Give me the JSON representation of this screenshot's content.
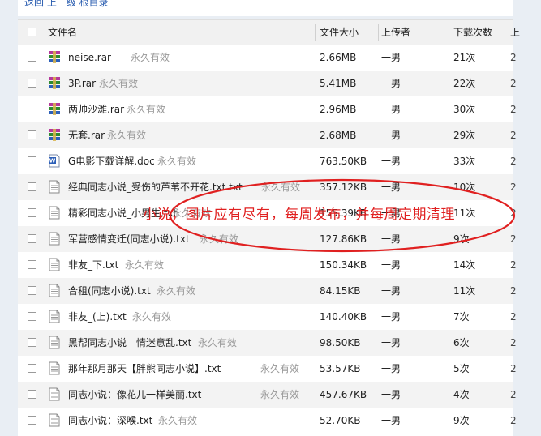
{
  "breadcrumb": "返回  上一级  根目录",
  "headers": {
    "name": "文件名",
    "size": "文件大小",
    "uploader": "上传者",
    "downloads": "下载次数",
    "extra": "上"
  },
  "colors": {
    "annotation": "#e02020",
    "rar_icon": "#2f8a2f",
    "doc_icon": "#2c5fb8"
  },
  "files": [
    {
      "name": "neise.rar",
      "perm": "永久有效",
      "size": "2.66MB",
      "uploader": "一男",
      "downloads": "21次",
      "icon": "winrar-icon",
      "extra": "2"
    },
    {
      "name": "3P.rar",
      "perm": "永久有效",
      "size": "5.41MB",
      "uploader": "一男",
      "downloads": "22次",
      "icon": "winrar-icon",
      "extra": "2"
    },
    {
      "name": "两帅沙滩.rar",
      "perm": "永久有效",
      "size": "2.96MB",
      "uploader": "一男",
      "downloads": "30次",
      "icon": "winrar-icon",
      "extra": "2"
    },
    {
      "name": "无套.rar",
      "perm": "永久有效",
      "size": "2.68MB",
      "uploader": "一男",
      "downloads": "29次",
      "icon": "winrar-icon",
      "extra": "2"
    },
    {
      "name": "G电影下载详解.doc",
      "perm": "永久有效",
      "size": "763.50KB",
      "uploader": "一男",
      "downloads": "33次",
      "icon": "word-doc-icon",
      "extra": "2"
    },
    {
      "name": "经典同志小说_受伤的芦苇不开花.txt.txt",
      "perm": "永久有效",
      "size": "357.12KB",
      "uploader": "一男",
      "downloads": "10次",
      "icon": "text-file-icon",
      "extra": "2"
    },
    {
      "name": "精彩同志小说_小男生.txt",
      "perm": "永久有效",
      "size": "155.39KB",
      "uploader": "一男",
      "downloads": "11次",
      "icon": "text-file-icon",
      "extra": "2"
    },
    {
      "name": "军营感情变迁(同志小说).txt",
      "perm": "永久有效",
      "size": "127.86KB",
      "uploader": "一男",
      "downloads": "9次",
      "icon": "text-file-icon",
      "extra": "2"
    },
    {
      "name": "非友_下.txt",
      "perm": "永久有效",
      "size": "150.34KB",
      "uploader": "一男",
      "downloads": "14次",
      "icon": "text-file-icon",
      "extra": "2"
    },
    {
      "name": "合租(同志小说).txt",
      "perm": "永久有效",
      "size": "84.15KB",
      "uploader": "一男",
      "downloads": "11次",
      "icon": "text-file-icon",
      "extra": "2"
    },
    {
      "name": "非友_(上).txt",
      "perm": "永久有效",
      "size": "140.40KB",
      "uploader": "一男",
      "downloads": "7次",
      "icon": "text-file-icon",
      "extra": "2"
    },
    {
      "name": "黑帮同志小说__情迷意乱.txt",
      "perm": "永久有效",
      "size": "98.50KB",
      "uploader": "一男",
      "downloads": "6次",
      "icon": "text-file-icon",
      "extra": "2"
    },
    {
      "name": "那年那月那天【胖熊同志小说】.txt",
      "perm": "永久有效",
      "size": "53.57KB",
      "uploader": "一男",
      "downloads": "5次",
      "icon": "text-file-icon",
      "extra": "2"
    },
    {
      "name": "同志小说：像花儿一样美丽.txt",
      "perm": "永久有效",
      "size": "457.67KB",
      "uploader": "一男",
      "downloads": "4次",
      "icon": "text-file-icon",
      "extra": "2"
    },
    {
      "name": "同志小说：深喉.txt",
      "perm": "永久有效",
      "size": "52.70KB",
      "uploader": "一男",
      "downloads": "9次",
      "icon": "text-file-icon",
      "extra": "2"
    }
  ],
  "annotation": "小说，图片应有尽有，每周发布，并每周定期清理"
}
